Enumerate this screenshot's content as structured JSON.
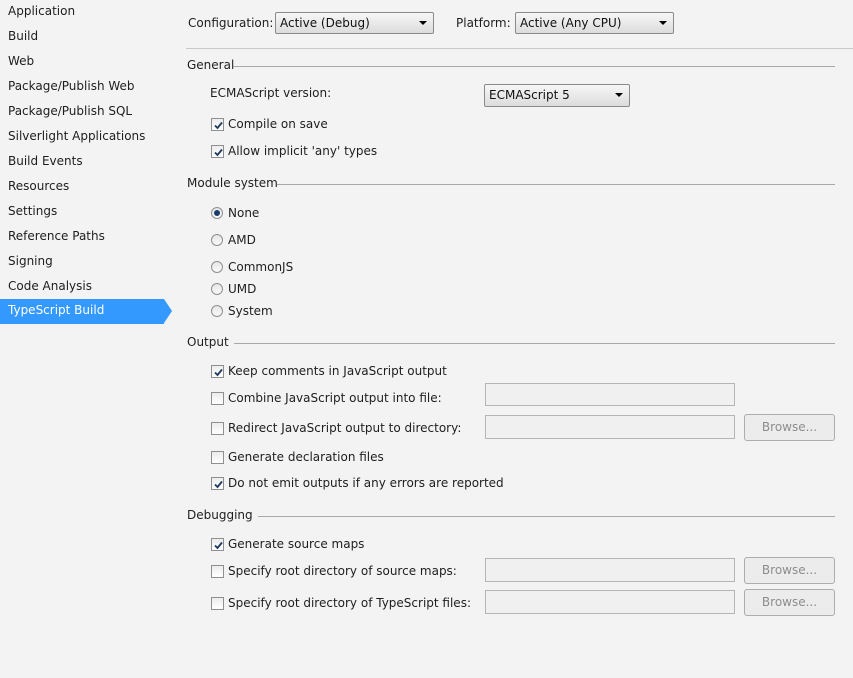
{
  "sidebar": {
    "items": [
      {
        "label": "Application"
      },
      {
        "label": "Build"
      },
      {
        "label": "Web"
      },
      {
        "label": "Package/Publish Web"
      },
      {
        "label": "Package/Publish SQL"
      },
      {
        "label": "Silverlight Applications"
      },
      {
        "label": "Build Events"
      },
      {
        "label": "Resources"
      },
      {
        "label": "Settings"
      },
      {
        "label": "Reference Paths"
      },
      {
        "label": "Signing"
      },
      {
        "label": "Code Analysis"
      },
      {
        "label": "TypeScript Build"
      }
    ],
    "selected": "TypeScript Build"
  },
  "header": {
    "configuration_label": "Configuration:",
    "configuration_value": "Active (Debug)",
    "platform_label": "Platform:",
    "platform_value": "Active (Any CPU)"
  },
  "general": {
    "title": "General",
    "ecmascript_label": "ECMAScript version:",
    "ecmascript_value": "ECMAScript 5",
    "compile_on_save": {
      "label": "Compile on save",
      "checked": true
    },
    "allow_implicit_any": {
      "label": "Allow implicit 'any' types",
      "checked": true
    }
  },
  "module_system": {
    "title": "Module system",
    "options": [
      {
        "label": "None",
        "selected": true
      },
      {
        "label": "AMD",
        "selected": false
      },
      {
        "label": "CommonJS",
        "selected": false
      },
      {
        "label": "UMD",
        "selected": false
      },
      {
        "label": "System",
        "selected": false
      }
    ]
  },
  "output": {
    "title": "Output",
    "keep_comments": {
      "label": "Keep comments in JavaScript output",
      "checked": true
    },
    "combine_output": {
      "label": "Combine JavaScript output into file:",
      "checked": false
    },
    "redirect_output": {
      "label": "Redirect JavaScript output to directory:",
      "checked": false
    },
    "generate_declarations": {
      "label": "Generate declaration files",
      "checked": false
    },
    "no_emit_on_error": {
      "label": "Do not emit outputs if any errors are reported",
      "checked": true
    },
    "browse_label": "Browse..."
  },
  "debugging": {
    "title": "Debugging",
    "source_maps": {
      "label": "Generate source maps",
      "checked": true
    },
    "map_root": {
      "label": "Specify root directory of source maps:",
      "checked": false
    },
    "source_root": {
      "label": "Specify root directory of TypeScript files:",
      "checked": false
    },
    "browse_label": "Browse..."
  },
  "colors": {
    "background": "#f3f3f3",
    "selected_nav": "#3399ff"
  }
}
